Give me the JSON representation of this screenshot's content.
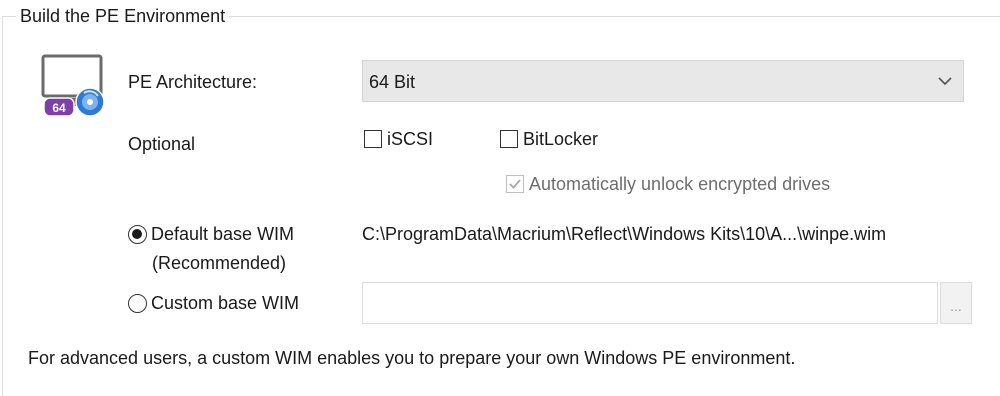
{
  "group": {
    "title": "Build the PE Environment"
  },
  "icon": {
    "name": "monitor-disc-icon",
    "badge": "64"
  },
  "architecture": {
    "label": "PE Architecture:",
    "selected": "64 Bit"
  },
  "optional": {
    "label": "Optional",
    "iscsi": {
      "label": "iSCSI",
      "checked": false
    },
    "bitlocker": {
      "label": "BitLocker",
      "checked": false
    },
    "auto_unlock": {
      "label": "Automatically unlock encrypted drives",
      "checked": true,
      "disabled": true
    }
  },
  "wim": {
    "default_label": "Default base WIM",
    "default_sublabel": "(Recommended)",
    "default_selected": true,
    "default_path": "C:\\ProgramData\\Macrium\\Reflect\\Windows Kits\\10\\A...\\winpe.wim",
    "custom_label": "Custom base WIM",
    "custom_selected": false,
    "custom_value": "",
    "browse_label": "..."
  },
  "footer": {
    "text": "For advanced users, a custom WIM enables you to prepare your own Windows PE environment."
  },
  "colors": {
    "badge_purple": "#7e3fa8",
    "disc_blue": "#2f7ad6"
  }
}
